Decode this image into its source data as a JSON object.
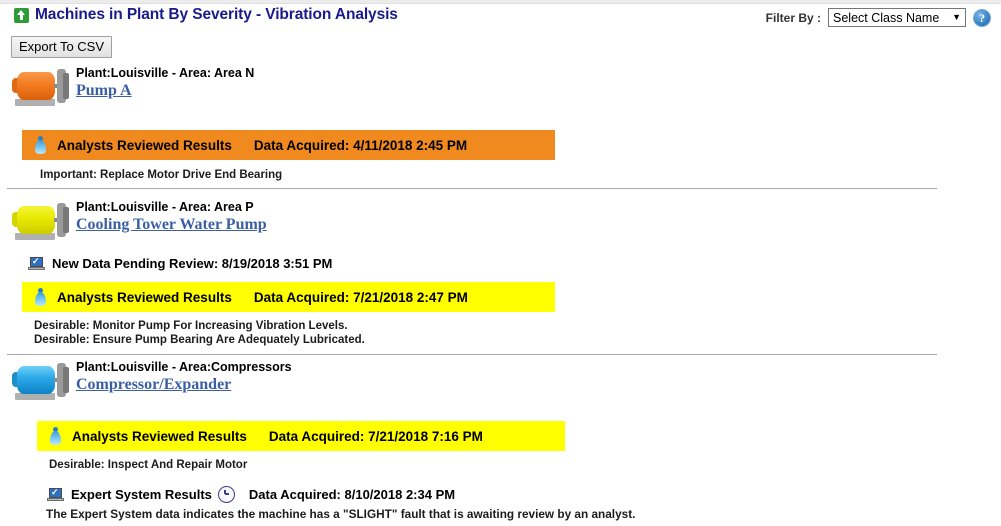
{
  "header": {
    "title": "Machines in Plant By Severity - Vibration Analysis",
    "title_icon": "up-arrow-icon",
    "filter_label": "Filter By :",
    "filter_value": "Select Class Name",
    "filter_caret": "▼",
    "help_icon_glyph": "?"
  },
  "toolbar": {
    "export_label": "Export To CSV"
  },
  "colors": {
    "title_blue": "#1a1a8c",
    "link_blue": "#3b5fa4",
    "banner_orange": "#f08a1e",
    "banner_yellow": "#ffff00",
    "machine_orange": "#f47b20",
    "machine_yellow": "#e8e800",
    "machine_blue": "#29a7e6",
    "divider_gray": "#a9a9a9"
  },
  "machines": [
    {
      "icon": "motor-icon-orange",
      "icon_color": "#f47b20",
      "plant_area": "Plant:Louisville - Area: Area N",
      "name": "Pump A",
      "pending": null,
      "banner": {
        "style": "orange",
        "icon": "analyst-icon",
        "label": "Analysts Reviewed Results",
        "acquired": "Data Acquired: 4/11/2018 2:45 PM"
      },
      "recommendations": [
        "Important: Replace Motor Drive End Bearing"
      ],
      "expert": null
    },
    {
      "icon": "motor-icon-yellow",
      "icon_color": "#e8e800",
      "plant_area": "Plant:Louisville - Area: Area P",
      "name": "Cooling Tower Water Pump",
      "pending": {
        "icon": "monitor-check-icon",
        "text": "New Data Pending Review: 8/19/2018 3:51 PM"
      },
      "banner": {
        "style": "yellow",
        "icon": "analyst-icon",
        "label": "Analysts Reviewed Results",
        "acquired": "Data Acquired: 7/21/2018 2:47 PM"
      },
      "recommendations": [
        "Desirable: Monitor Pump For Increasing Vibration Levels.",
        "Desirable: Ensure Pump Bearing Are Adequately Lubricated."
      ],
      "expert": null
    },
    {
      "icon": "motor-icon-blue",
      "icon_color": "#29a7e6",
      "plant_area": "Plant:Louisville - Area:Compressors",
      "name": "Compressor/Expander",
      "pending": null,
      "banner": {
        "style": "yellow",
        "icon": "analyst-icon",
        "label": "Analysts Reviewed Results",
        "acquired": "Data Acquired: 7/21/2018 7:16 PM"
      },
      "recommendations": [
        "Desirable: Inspect And Repair Motor"
      ],
      "expert": {
        "icon": "monitor-check-icon",
        "clock_icon": "clock-icon",
        "label": "Expert System Results",
        "acquired": "Data Acquired: 8/10/2018 2:34 PM",
        "description": "The Expert System data indicates the machine has a \"SLIGHT\" fault that is awaiting review by an analyst."
      }
    }
  ]
}
